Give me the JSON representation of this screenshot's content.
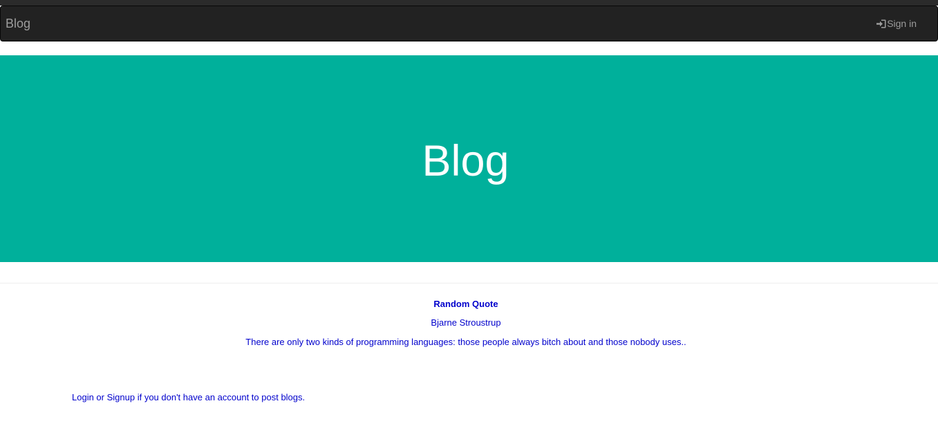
{
  "navbar": {
    "brand": "Blog",
    "signin_label": "Sign in",
    "signin_icon": "log-in-icon",
    "background": "#222222",
    "text_color": "#9d9d9d"
  },
  "hero": {
    "title": "Blog",
    "background": "#00b09b"
  },
  "quote": {
    "heading": "Random Quote",
    "author": "Bjarne Stroustrup",
    "text": "There are only two kinds of programming languages: those people always bitch about and those nobody uses..",
    "color": "#0000cc"
  },
  "login_note": {
    "login_link": "Login",
    "or": " or ",
    "signup_link": "Signup",
    "rest": " if you don't have an account to post blogs."
  }
}
